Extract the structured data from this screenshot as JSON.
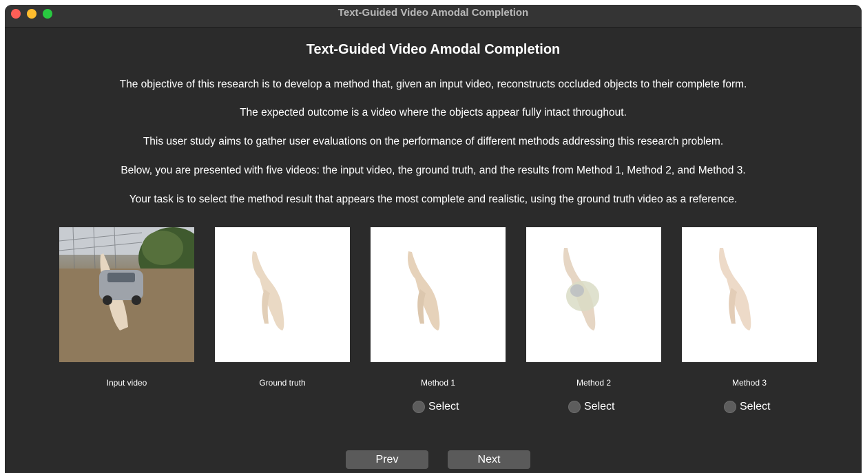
{
  "window": {
    "title": "Text-Guided Video Amodal Completion"
  },
  "heading": "Text-Guided Video Amodal Completion",
  "paragraphs": [
    "The objective of this research is to develop a method that, given an input video, reconstructs occluded objects to their complete form.",
    "The expected outcome is a video where the objects appear fully intact throughout.",
    "This user study aims to gather user evaluations on the performance of different methods addressing this research problem.",
    "Below, you are presented with five videos: the input video, the ground truth, and the results from Method 1, Method 2, and Method 3.",
    "Your task is to select the method result that appears the most complete and realistic, using the ground truth video as a reference."
  ],
  "videos": [
    {
      "label": "Input video"
    },
    {
      "label": "Ground truth"
    },
    {
      "label": "Method 1",
      "select_label": "Select"
    },
    {
      "label": "Method 2",
      "select_label": "Select"
    },
    {
      "label": "Method 3",
      "select_label": "Select"
    }
  ],
  "nav": {
    "prev": "Prev",
    "next": "Next"
  }
}
